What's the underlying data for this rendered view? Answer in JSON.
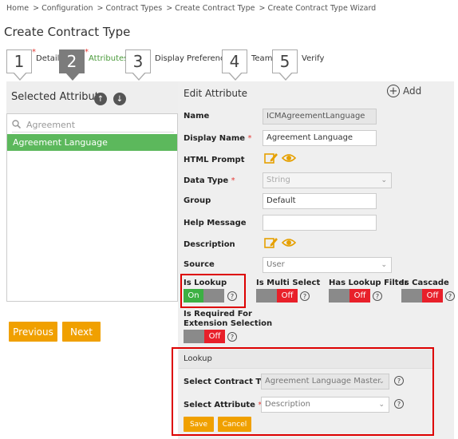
{
  "breadcrumb": [
    "Home",
    "> Configuration",
    "> Contract Types",
    "> Create Contract Type",
    "> Create Contract Type Wizard"
  ],
  "page_title": "Create Contract Type",
  "steps": [
    {
      "number": "1",
      "label": "Details",
      "required": true,
      "active": false
    },
    {
      "number": "2",
      "label": "Attributes",
      "required": true,
      "active": true
    },
    {
      "number": "3",
      "label": "Display Preference",
      "required": false,
      "active": false
    },
    {
      "number": "4",
      "label": "Team",
      "required": false,
      "active": false
    },
    {
      "number": "5",
      "label": "Verify",
      "required": false,
      "active": false
    }
  ],
  "required_marker": "*",
  "selected_attribute": {
    "title": "Selected Attribute",
    "up_icon": "arrow-up-icon",
    "down_icon": "arrow-down-icon",
    "search_value": "Agreement",
    "items": [
      "Agreement Language"
    ]
  },
  "nav": {
    "previous": "Previous",
    "next": "Next"
  },
  "edit": {
    "title": "Edit  Attribute",
    "add_label": "Add",
    "fields": {
      "name": {
        "label": "Name",
        "value": "ICMAgreementLanguage"
      },
      "display_name": {
        "label": "Display Name",
        "value": "Agreement Language"
      },
      "html_prompt": {
        "label": "HTML Prompt"
      },
      "data_type": {
        "label": "Data Type",
        "value": "String"
      },
      "group": {
        "label": "Group",
        "value": "Default"
      },
      "help_message": {
        "label": "Help Message",
        "value": ""
      },
      "description": {
        "label": "Description"
      },
      "source": {
        "label": "Source",
        "value": "User"
      }
    },
    "toggles": {
      "is_lookup": {
        "label": "Is Lookup",
        "state": "On"
      },
      "is_multi_select": {
        "label": "Is Multi Select",
        "state": "Off"
      },
      "has_lookup_filter": {
        "label": "Has Lookup Filter",
        "state": "Off"
      },
      "is_cascade": {
        "label": "Is Cascade",
        "state": "Off"
      },
      "is_required_ext": {
        "label_line1": "Is Required For",
        "label_line2": "Extension Selection",
        "state": "Off"
      }
    },
    "help_glyph": "?"
  },
  "lookup": {
    "title": "Lookup",
    "contract_type_label": "Select Contract Type",
    "contract_type_value": "Agreement Language Master",
    "attribute_label": "Select Attribute",
    "attribute_value": "Description",
    "save": "Save",
    "cancel": "Cancel"
  },
  "colors": {
    "accent_orange": "#f0a000",
    "active_green": "#5cb85c",
    "toggle_on": "#3cb043",
    "toggle_off": "#e8202a",
    "highlight_red": "#dd0000",
    "icon_orange": "#e6a000"
  }
}
